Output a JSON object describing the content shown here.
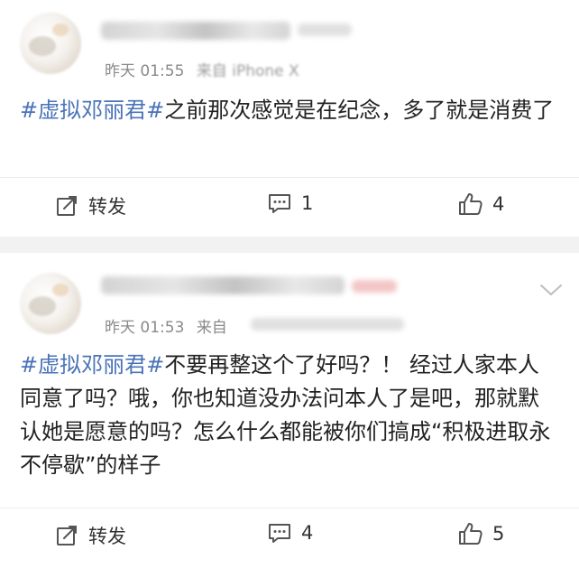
{
  "posts": [
    {
      "time": "昨天 01:55",
      "source": "来自 iPhone X",
      "hashtag": "#虚拟邓丽君#",
      "text": "之前那次感觉是在纪念，多了就是消费了",
      "actions": {
        "forward_label": "转发",
        "comment_count": "1",
        "like_count": "4"
      }
    },
    {
      "time": "昨天 01:53",
      "source": "来自",
      "hashtag": "#虚拟邓丽君#",
      "text": "不要再整这个了好吗？！ 经过人家本人同意了吗？哦，你也知道没办法问本人了是吧，那就默认她是愿意的吗？怎么什么都能被你们搞成“积极进取永不停歇”的样子",
      "actions": {
        "forward_label": "转发",
        "comment_count": "4",
        "like_count": "5"
      }
    }
  ],
  "icons": {
    "forward": "forward-icon",
    "comment": "comment-icon",
    "like": "thumbs-up-icon",
    "more": "chevron-down-icon"
  },
  "colors": {
    "hashtag": "#4a73b9",
    "meta": "#8a8a8a",
    "background": "#f2f2f2"
  }
}
